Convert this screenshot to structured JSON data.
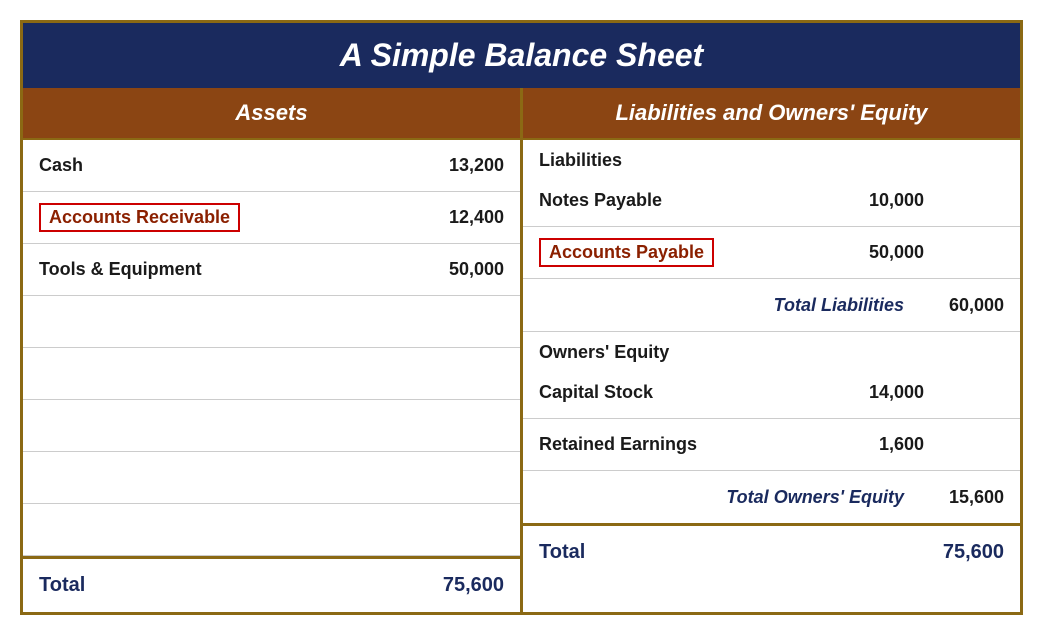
{
  "title": "A Simple Balance Sheet",
  "headers": {
    "left": "Assets",
    "right": "Liabilities and Owners' Equity"
  },
  "assets": {
    "rows": [
      {
        "label": "Cash",
        "value": "13,200",
        "highlighted": false
      },
      {
        "label": "Accounts Receivable",
        "value": "12,400",
        "highlighted": true
      },
      {
        "label": "Tools & Equipment",
        "value": "50,000",
        "highlighted": false
      }
    ],
    "total_label": "Total",
    "total_value": "75,600"
  },
  "liabilities": {
    "section_label": "Liabilities",
    "rows": [
      {
        "label": "Notes Payable",
        "value": "10,000",
        "highlighted": false
      },
      {
        "label": "Accounts Payable",
        "value": "50,000",
        "highlighted": true
      }
    ],
    "total_label": "Total Liabilities",
    "total_value": "60,000",
    "equity_section": "Owners' Equity",
    "equity_rows": [
      {
        "label": "Capital Stock",
        "value": "14,000"
      },
      {
        "label": "Retained Earnings",
        "value": "1,600"
      }
    ],
    "equity_total_label": "Total Owners' Equity",
    "equity_total_value": "15,600",
    "total_label2": "Total",
    "total_value2": "75,600"
  }
}
